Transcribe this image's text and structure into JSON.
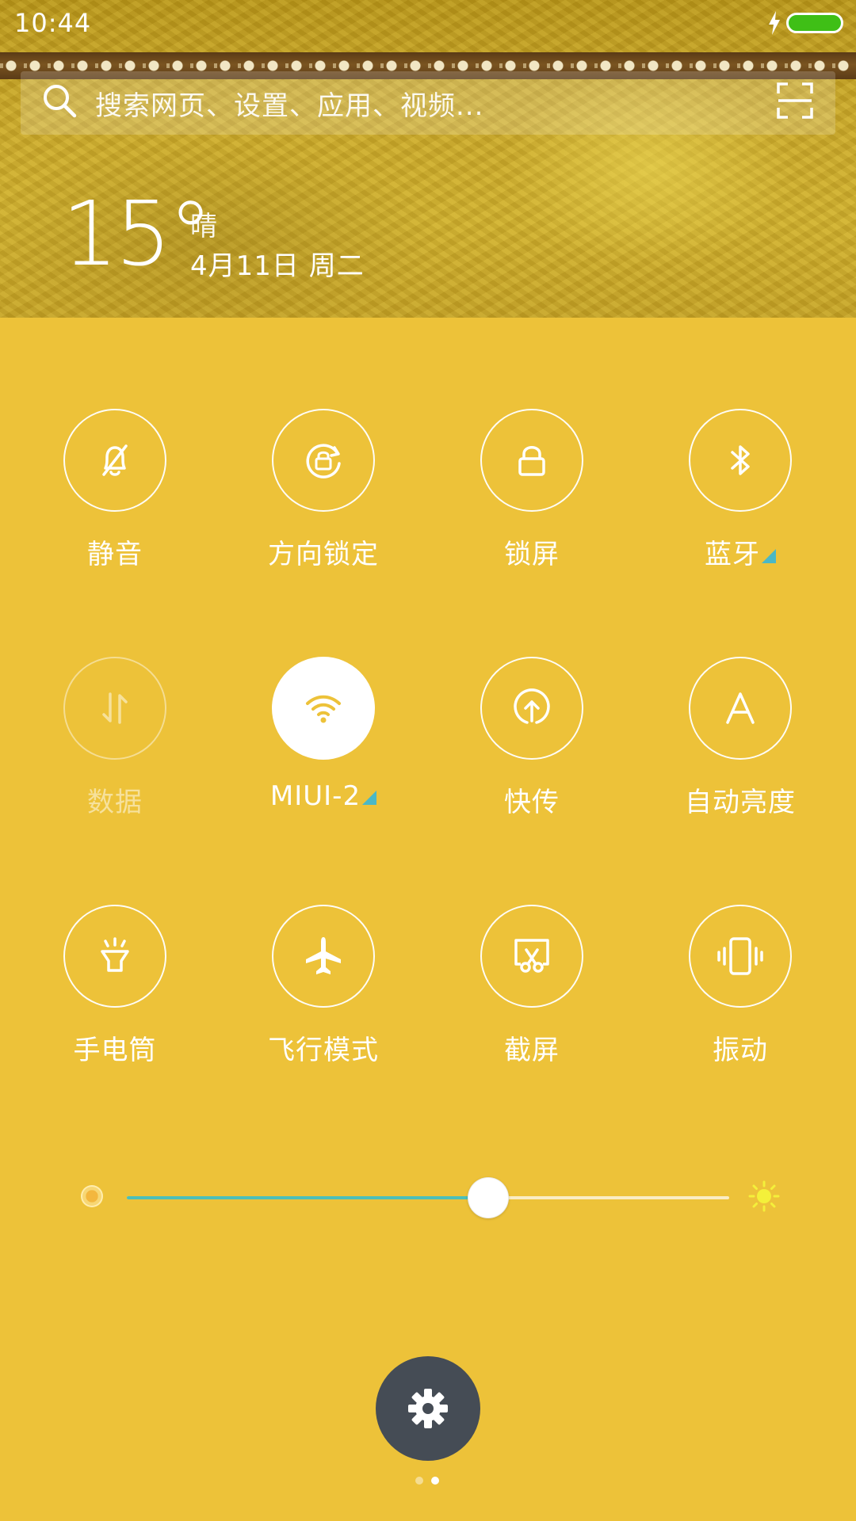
{
  "status_bar": {
    "time": "10:44",
    "battery_color": "#3FBF16"
  },
  "search": {
    "placeholder": "搜索网页、设置、应用、视频...",
    "search_icon": "search-icon",
    "scan_icon": "scan-icon"
  },
  "weather": {
    "temperature": "15°",
    "condition": "晴",
    "date": "4月11日 周二"
  },
  "toggles": [
    {
      "label": "静音",
      "icon": "bell-off-icon",
      "state": "off",
      "has_more": false
    },
    {
      "label": "方向锁定",
      "icon": "rotation-lock-icon",
      "state": "off",
      "has_more": false
    },
    {
      "label": "锁屏",
      "icon": "lock-icon",
      "state": "off",
      "has_more": false
    },
    {
      "label": "蓝牙",
      "icon": "bluetooth-icon",
      "state": "off",
      "has_more": true
    },
    {
      "label": "数据",
      "icon": "data-arrows-icon",
      "state": "disabled",
      "has_more": false
    },
    {
      "label": "MIUI-2",
      "icon": "wifi-icon",
      "state": "on",
      "has_more": true
    },
    {
      "label": "快传",
      "icon": "quick-share-icon",
      "state": "off",
      "has_more": false
    },
    {
      "label": "自动亮度",
      "icon": "auto-brightness-icon",
      "state": "off",
      "has_more": false
    },
    {
      "label": "手电筒",
      "icon": "flashlight-icon",
      "state": "off",
      "has_more": false
    },
    {
      "label": "飞行模式",
      "icon": "airplane-icon",
      "state": "off",
      "has_more": false
    },
    {
      "label": "截屏",
      "icon": "screenshot-icon",
      "state": "off",
      "has_more": false
    },
    {
      "label": "振动",
      "icon": "vibrate-icon",
      "state": "off",
      "has_more": false
    }
  ],
  "brightness": {
    "level": 0.6,
    "accent": "#4DBFB8"
  },
  "settings_button": {
    "icon": "gear-icon"
  },
  "pager": {
    "total": 2,
    "current": 2
  },
  "colors": {
    "panel_background": "#EDC239",
    "settings_button": "#454C55",
    "more_indicator": "#4BB8C6"
  }
}
